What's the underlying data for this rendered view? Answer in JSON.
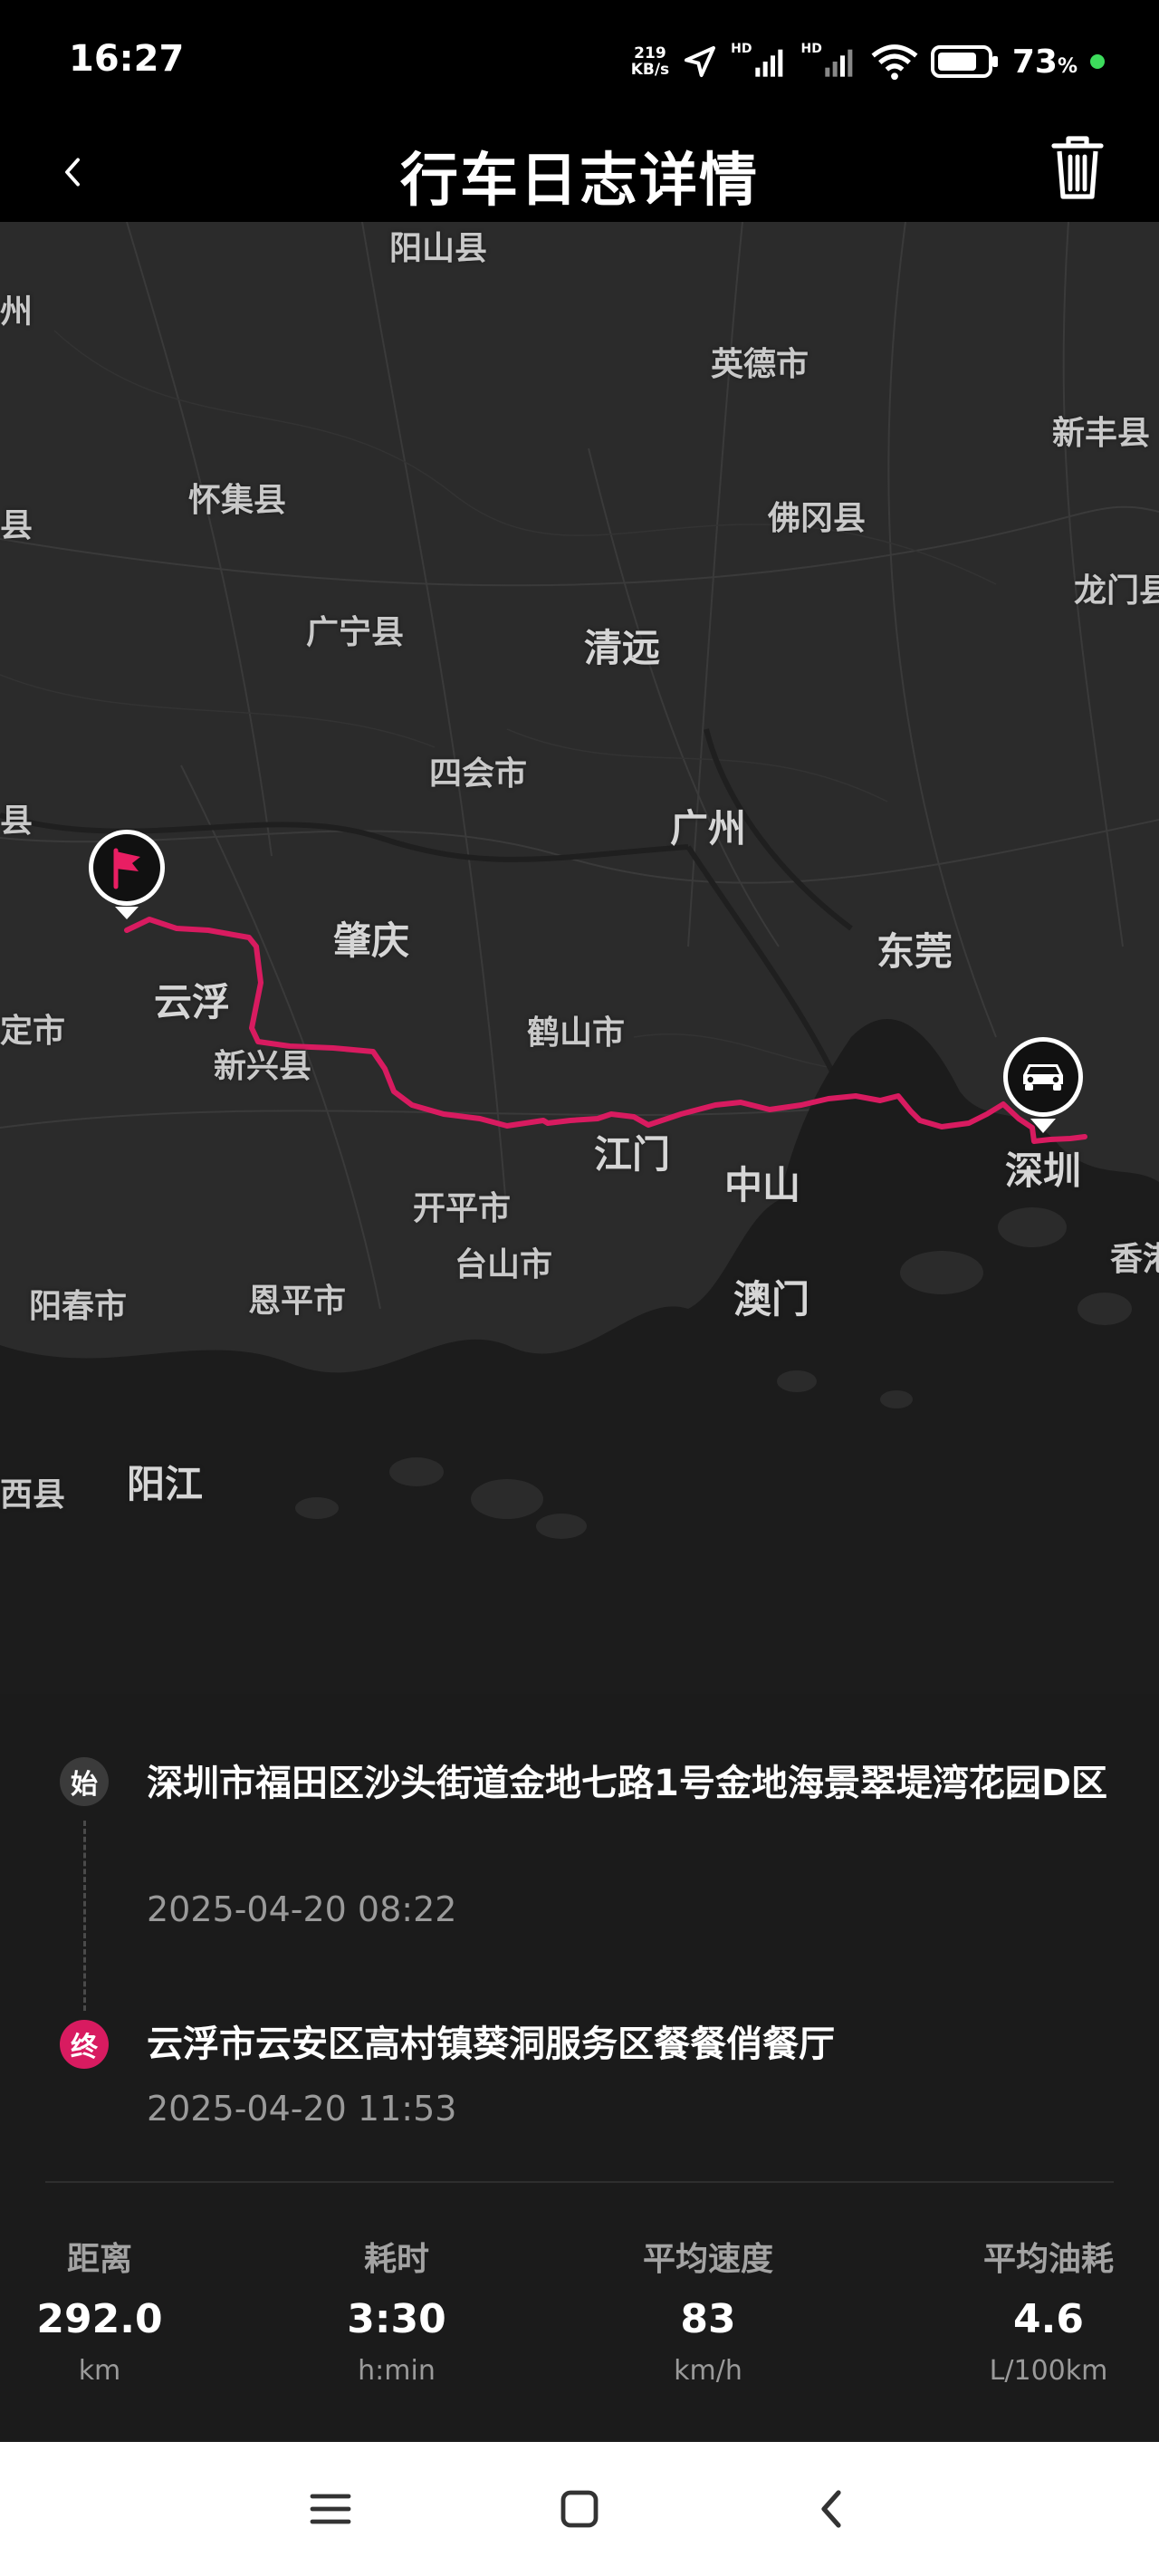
{
  "status": {
    "time": "16:27",
    "net_speed_value": "219",
    "net_speed_unit": "KB/s",
    "hd1": "HD",
    "hd2": "HD",
    "battery_percent": "73",
    "battery_suffix": "%"
  },
  "header": {
    "title": "行车日志详情"
  },
  "map": {
    "labels": [
      "阳山县",
      "英德市",
      "新丰县",
      "怀集县",
      "佛冈县",
      "龙门县",
      "广宁县",
      "清远",
      "四会市",
      "广州",
      "肇庆",
      "东莞",
      "云浮",
      "新兴县",
      "鹤山市",
      "深圳",
      "江门",
      "中山",
      "开平市",
      "台山市",
      "恩平市",
      "阳春市",
      "澳门",
      "香港",
      "阳江",
      "西县",
      "州",
      "县",
      "县",
      "定市"
    ],
    "route_color": "#d81b60"
  },
  "trip": {
    "start_pin": "始",
    "start_address": "深圳市福田区沙头街道金地七路1号金地海景翠堤湾花园D区",
    "start_time": "2025-04-20 08:22",
    "end_pin": "终",
    "end_address": "云浮市云安区高村镇葵洞服务区餐餐俏餐厅",
    "end_time": "2025-04-20 11:53"
  },
  "stats": [
    {
      "label": "距离",
      "value": "292.0",
      "unit": "km"
    },
    {
      "label": "耗时",
      "value": "3:30",
      "unit": "h:min"
    },
    {
      "label": "平均速度",
      "value": "83",
      "unit": "km/h"
    },
    {
      "label": "平均油耗",
      "value": "4.6",
      "unit": "L/100km"
    }
  ]
}
